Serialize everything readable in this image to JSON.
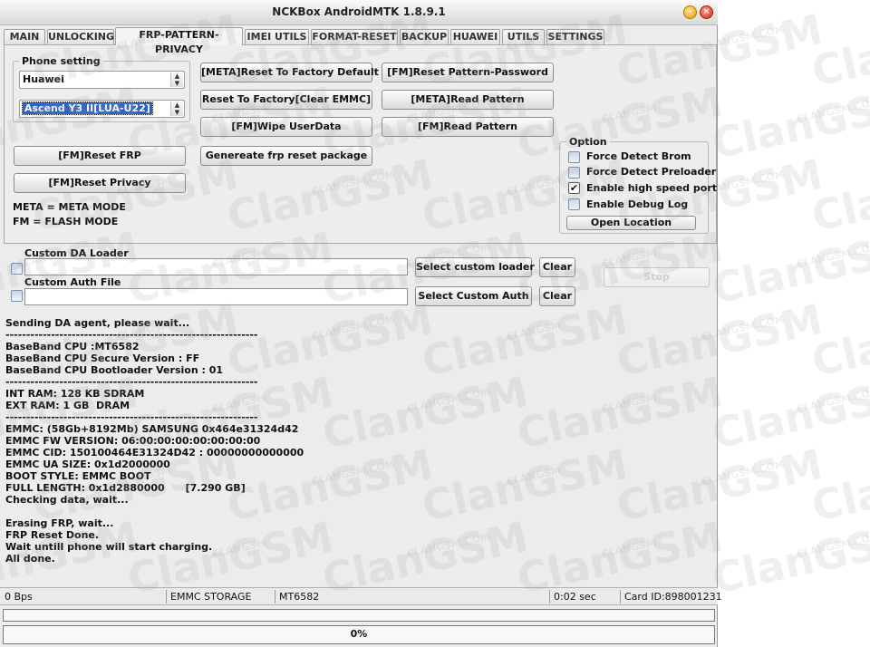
{
  "window": {
    "title": "NCKBox AndroidMTK 1.8.9.1"
  },
  "colors": {
    "accent_selection": "#2a62c9",
    "progress_fill": "#4caf50",
    "close_button": "#d22a10",
    "minimize_button": "#e59b00"
  },
  "tabs": [
    {
      "label": "MAIN"
    },
    {
      "label": "UNLOCKING"
    },
    {
      "label": "FRP-PATTERN-PRIVACY",
      "active": true
    },
    {
      "label": "IMEI UTILS"
    },
    {
      "label": "FORMAT-RESET"
    },
    {
      "label": "BACKUP"
    },
    {
      "label": "HUAWEI"
    },
    {
      "label": "UTILS"
    },
    {
      "label": "SETTINGS"
    }
  ],
  "phone_setting": {
    "title": "Phone setting",
    "brand": "Huawei",
    "model": "Ascend Y3 II[LUA-U22]"
  },
  "buttons": {
    "meta_reset_factory": "[META]Reset To Factory Default",
    "fm_reset_pattern_password": "[FM]Reset Pattern-Password",
    "reset_factory_clear_emmc": "Reset To Factory[Clear EMMC]",
    "meta_read_pattern": "[META]Read Pattern",
    "fm_wipe_userdata": "[FM]Wipe UserData",
    "fm_read_pattern": "[FM]Read Pattern",
    "fm_reset_frp": "[FM]Reset FRP",
    "generate_frp_package": "Genereate frp reset package",
    "fm_reset_privacy": "[FM]Reset Privacy",
    "select_custom_loader": "Select custom loader",
    "clear_loader": "Clear",
    "select_custom_auth": "Select Custom Auth",
    "clear_auth": "Clear",
    "stop": "Stop"
  },
  "legend": {
    "meta": "META = META MODE",
    "fm": "FM = FLASH MODE"
  },
  "options": {
    "title": "Option",
    "items": [
      {
        "label": "Force Detect Brom",
        "checked": false
      },
      {
        "label": "Force Detect Preloader",
        "checked": false
      },
      {
        "label": "Enable high speed port",
        "checked": true
      },
      {
        "label": "Enable Debug Log",
        "checked": false
      }
    ],
    "open_location": "Open Location"
  },
  "custom_da": {
    "label": "Custom DA Loader",
    "value": ""
  },
  "custom_auth": {
    "label": "Custom Auth File",
    "value": ""
  },
  "log": [
    "Sending DA agent, please wait...",
    "-------------------------------------------------------------",
    "BaseBand CPU :MT6582",
    "BaseBand CPU Secure Version : FF",
    "BaseBand CPU Bootloader Version : 01",
    "-------------------------------------------------------------",
    "INT RAM: 128 KB SDRAM",
    "EXT RAM: 1 GB  DRAM",
    "-------------------------------------------------------------",
    "EMMC: (58Gb+8192Mb) SAMSUNG 0x464e31324d42",
    "EMMC FW VERSION: 06:00:00:00:00:00:00:00",
    "EMMC CID: 150100464E31324D42 : 00000000000000",
    "EMMC UA SIZE: 0x1d2000000",
    "BOOT STYLE: EMMC BOOT",
    "FULL LENGTH: 0x1d2880000      [7.290 GB]",
    "Checking data, wait...",
    "",
    "Erasing FRP, wait...",
    "FRP Reset Done.",
    "Wait untill phone will start charging.",
    "All done."
  ],
  "status": {
    "speed": "0 Bps",
    "storage": "EMMC STORAGE",
    "chip": "MT6582",
    "time": "0:02 sec",
    "card_id": "Card ID:898001231"
  },
  "progress": {
    "bar1_fraction": 0,
    "bar2_fraction": 0,
    "bar2_text": "0%"
  },
  "watermark": {
    "big": "ClanGSM",
    "small": "CLANGSM",
    "url": "CLANGSM.COM"
  }
}
